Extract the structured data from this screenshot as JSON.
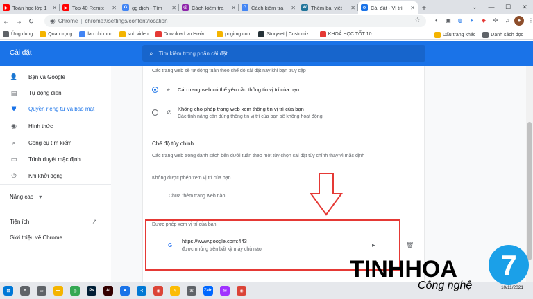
{
  "tabs": [
    {
      "title": "Toán học lớp 1",
      "color": "#ff0000",
      "glyph": "▶"
    },
    {
      "title": "Top 40 Remix",
      "color": "#ff0000",
      "glyph": "▶"
    },
    {
      "title": "gg dịch - Tìm",
      "color": "#4285f4",
      "glyph": "G"
    },
    {
      "title": "Cách kiểm tra",
      "color": "#8e24aa",
      "glyph": "@"
    },
    {
      "title": "Cách kiểm tra",
      "color": "#4285f4",
      "glyph": "G"
    },
    {
      "title": "Thêm bài viết",
      "color": "#21759b",
      "glyph": "W"
    },
    {
      "title": "Cài đặt - Vị trí",
      "color": "#1a73e8",
      "glyph": "⚙"
    }
  ],
  "toolbar": {
    "site": "Chrome",
    "url": "chrome://settings/content/location"
  },
  "bookmarks": [
    {
      "label": "Ứng dụng",
      "color": "#5f6368"
    },
    {
      "label": "Quan trọng",
      "color": "#f4b400"
    },
    {
      "label": "lap chi muc",
      "color": "#4285f4"
    },
    {
      "label": "sub video",
      "color": "#f4b400"
    },
    {
      "label": "Download.vn Hướn...",
      "color": "#e53935"
    },
    {
      "label": "pngimg.com",
      "color": "#f4b400"
    },
    {
      "label": "Storyset | Customiz...",
      "color": "#263238"
    },
    {
      "label": "KHOÁ HỌC TỐT 10...",
      "color": "#e53935"
    }
  ],
  "bookmarks_right": [
    {
      "label": "Dấu trang khác",
      "color": "#f4b400"
    },
    {
      "label": "Danh sách đọc",
      "color": "#5f6368"
    }
  ],
  "settings": {
    "title": "Cài đặt",
    "search_placeholder": "Tìm kiếm trong phần cài đặt"
  },
  "sidebar": {
    "items": [
      {
        "label": "Bạn và Google",
        "icon": "person-icon",
        "glyph": "👤"
      },
      {
        "label": "Tự động điền",
        "icon": "autofill-icon",
        "glyph": "▤"
      },
      {
        "label": "Quyền riêng tư và bảo mật",
        "icon": "shield-icon",
        "glyph": "⛊"
      },
      {
        "label": "Hình thức",
        "icon": "palette-icon",
        "glyph": "◉"
      },
      {
        "label": "Công cụ tìm kiếm",
        "icon": "search-icon",
        "glyph": "⌕"
      },
      {
        "label": "Trình duyệt mặc định",
        "icon": "browser-icon",
        "glyph": "▭"
      },
      {
        "label": "Khi khởi động",
        "icon": "power-icon",
        "glyph": "⏻"
      }
    ],
    "advanced": "Nâng cao",
    "extensions": "Tiện ích",
    "about": "Giới thiệu về Chrome"
  },
  "content": {
    "default_desc": "Các trang web sẽ tự động tuân theo chế độ cài đặt này khi bạn truy cập",
    "option_allow": "Các trang web có thể yêu cầu thông tin vị trí của bạn",
    "option_block": "Không cho phép trang web xem thông tin vị trí của bạn",
    "option_block_sub": "Các tính năng cần dùng thông tin vị trí của bạn sẽ không hoạt động",
    "custom_title": "Chế độ tùy chỉnh",
    "custom_desc": "Các trang web trong danh sách bên dưới tuân theo một tùy chọn cài đặt tùy chỉnh thay vì mặc định",
    "blocked_title": "Không được phép xem vị trí của bạn",
    "blocked_empty": "Chưa thêm trang web nào",
    "allowed_title": "Được phép xem vị trí của bạn",
    "allowed_site": "https://www.google.com:443",
    "allowed_site_sub": "được nhúng trên bất kỳ máy chủ nào"
  },
  "watermark": {
    "brand": "TINHHOA",
    "tagline": "Công nghệ",
    "badge": "7"
  },
  "clock": {
    "date": "10/11/2021"
  },
  "taskbar": [
    {
      "icon": "windows-icon",
      "color": "#0078d7",
      "glyph": "⊞"
    },
    {
      "icon": "search-icon",
      "color": "#5f6368",
      "glyph": "⌕"
    },
    {
      "icon": "taskview-icon",
      "color": "#5f6368",
      "glyph": "▭"
    },
    {
      "icon": "explorer-icon",
      "color": "#f4b400",
      "glyph": "▬"
    },
    {
      "icon": "app-icon",
      "color": "#34a853",
      "glyph": "◎"
    },
    {
      "icon": "photoshop-icon",
      "color": "#001e36",
      "glyph": "Ps"
    },
    {
      "icon": "illustrator-icon",
      "color": "#330000",
      "glyph": "Ai"
    },
    {
      "icon": "app2-icon",
      "color": "#1a73e8",
      "glyph": "●"
    },
    {
      "icon": "vscode-icon",
      "color": "#0078d4",
      "glyph": "≺"
    },
    {
      "icon": "chrome-icon",
      "color": "#db4437",
      "glyph": "◉"
    },
    {
      "icon": "paint-icon",
      "color": "#fbbc05",
      "glyph": "✎"
    },
    {
      "icon": "network-icon",
      "color": "#5f6368",
      "glyph": "⌘"
    },
    {
      "icon": "zalo-icon",
      "color": "#0068ff",
      "glyph": "Zalo"
    },
    {
      "icon": "messenger-icon",
      "color": "#a033ff",
      "glyph": "✉"
    },
    {
      "icon": "chrome2-icon",
      "color": "#db4437",
      "glyph": "◉"
    }
  ]
}
